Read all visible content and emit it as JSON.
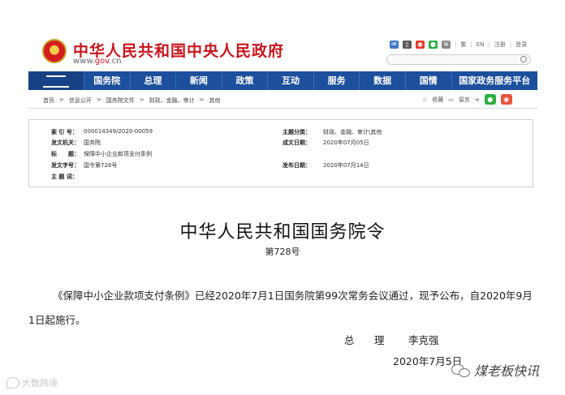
{
  "header": {
    "site_title": "中华人民共和国中央人民政府",
    "site_url_pre": "www.",
    "site_url_gov": "gov",
    "site_url_post": ".cn",
    "top_links": {
      "traditional": "繁",
      "english": "EN",
      "register": "注册",
      "login": "登录"
    }
  },
  "nav": {
    "items": [
      "国务院",
      "总理",
      "新闻",
      "政策",
      "互动",
      "服务",
      "数据",
      "国情",
      "国家政务服务平台"
    ]
  },
  "breadcrumb": [
    "首页",
    "信息公开",
    "国务院文件",
    "财政、金融、审计",
    "其他"
  ],
  "tools": {
    "favorite": "收藏",
    "comment": "留言"
  },
  "info": {
    "index_label": "索 引 号：",
    "index_value": "000014349/2020-00059",
    "subject_label": "主题分类：",
    "subject_value": "财政、金融、审计\\其他",
    "issuer_label": "发文机关：",
    "issuer_value": "国务院",
    "written_label": "成文日期：",
    "written_value": "2020年07月05日",
    "title_label": "标　　题：",
    "title_value": "保障中小企业款项支付条例",
    "docno_label": "发文字号：",
    "docno_value": "国令第728号",
    "published_label": "发布日期：",
    "published_value": "2020年07月14日",
    "keywords_label": "主 题 词："
  },
  "document": {
    "title": "中华人民共和国国务院令",
    "number": "第728号",
    "paragraph": "《保障中小企业款项支付条例》已经2020年7月1日国务院第99次常务会议通过，现予公布，自2020年9月1日起施行。",
    "sign_role": "总　理",
    "sign_name": "李克强",
    "sign_date": "2020年7月5日"
  },
  "watermarks": {
    "left": "大数跨境",
    "right": "煤老板快讯"
  }
}
